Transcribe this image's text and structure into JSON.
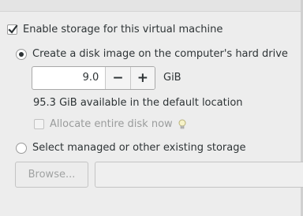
{
  "storage": {
    "enable_label": "Enable storage for this virtual machine",
    "enable_checked": true
  },
  "create_disk": {
    "label": "Create a disk image on the computer's hard drive",
    "selected": true,
    "size_value": "9.0",
    "decrement_symbol": "−",
    "increment_symbol": "+",
    "unit": "GiB",
    "available_text": "95.3 GiB available in the default location",
    "allocate_label": "Allocate entire disk now",
    "allocate_checked": false,
    "allocate_enabled": false
  },
  "existing_storage": {
    "label": "Select managed or other existing storage",
    "selected": false,
    "browse_label": "Browse...",
    "path_value": ""
  }
}
